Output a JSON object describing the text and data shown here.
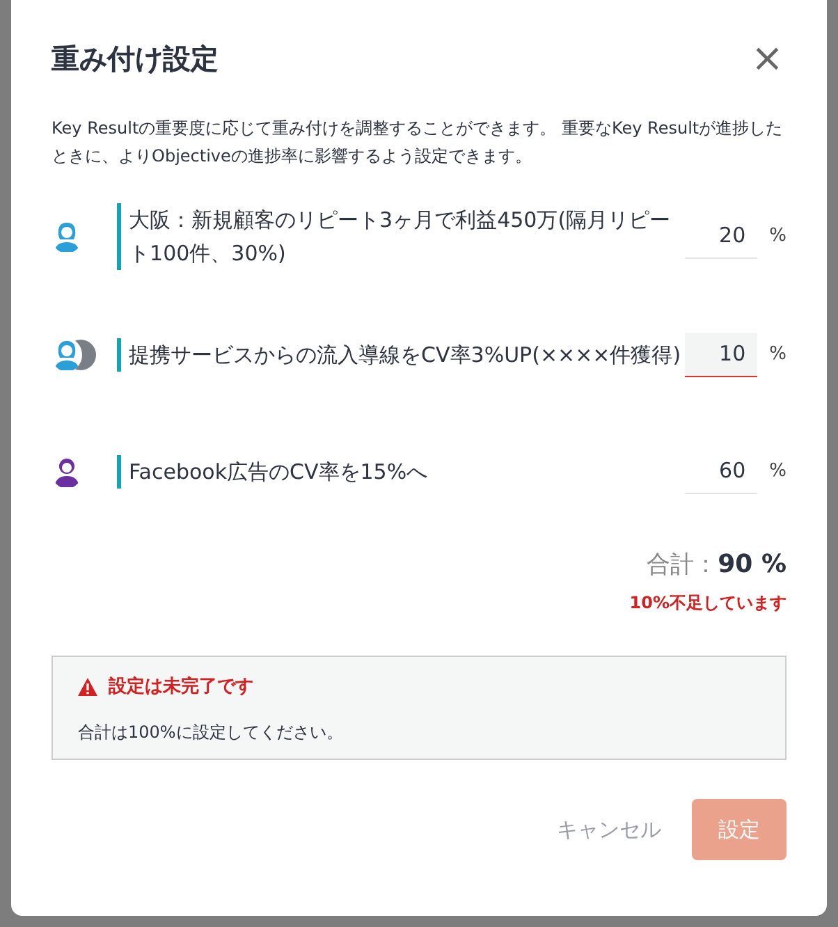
{
  "dialog": {
    "title": "重み付け設定",
    "close": "×",
    "description": "Key Resultの重要度に応じて重み付けを調整することができます。 重要なKey Resultが進捗したときに、よりObjectiveの進捗率に影響するよう設定できます。"
  },
  "key_results": [
    {
      "avatars": [
        {
          "kind": "female",
          "color": "#2b9fd8"
        }
      ],
      "title": "大阪：新規顧客のリピート3ヶ月で利益450万(隔月リピート100件、30%)",
      "weight": "20",
      "unit": "%",
      "focused": false
    },
    {
      "avatars": [
        {
          "kind": "female",
          "color": "#2b9fd8"
        },
        {
          "kind": "other",
          "color": "#7a7f87"
        }
      ],
      "title": "提携サービスからの流入導線をCV率3%UP(××××件獲得)",
      "weight": "10",
      "unit": "%",
      "focused": true
    },
    {
      "avatars": [
        {
          "kind": "male",
          "color": "#6b2fa0"
        }
      ],
      "title": "Facebook広告のCV率を15%へ",
      "weight": "60",
      "unit": "%",
      "focused": false
    }
  ],
  "total": {
    "label": "合計：",
    "value": "90 %",
    "warning": "10%不足しています"
  },
  "alert": {
    "title": "設定は未完了です",
    "message": "合計は100%に設定してください。"
  },
  "buttons": [
    {
      "kind": "cancel",
      "label": "キャンセル",
      "disabled": false
    },
    {
      "kind": "submit",
      "label": "設定",
      "disabled": true
    }
  ]
}
